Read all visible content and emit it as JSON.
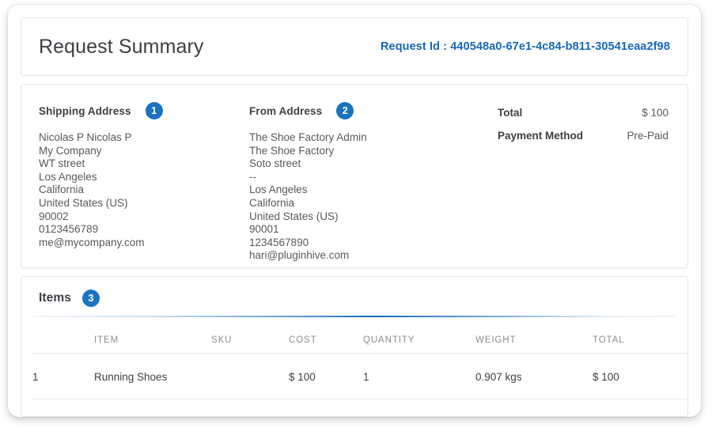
{
  "header": {
    "title": "Request Summary",
    "request_id_label": "Request Id : 440548a0-67e1-4c84-b811-30541eaa2f98",
    "accent_color": "#1668b8"
  },
  "addresses": {
    "shipping": {
      "heading": "Shipping Address",
      "badge": "1",
      "lines": [
        "Nicolas P Nicolas P",
        "My Company",
        "WT street",
        "Los Angeles",
        "California",
        "United States (US)",
        "90002",
        "0123456789",
        "me@mycompany.com"
      ]
    },
    "from": {
      "heading": "From Address",
      "badge": "2",
      "lines": [
        "The Shoe Factory Admin",
        "The Shoe Factory",
        "Soto street",
        "--",
        "Los Angeles",
        "California",
        "United States (US)",
        "90001",
        "1234567890",
        "hari@pluginhive.com"
      ]
    }
  },
  "summary": {
    "rows": [
      {
        "label": "Total",
        "value": "$ 100"
      },
      {
        "label": "Payment Method",
        "value": "Pre-Paid"
      }
    ]
  },
  "items": {
    "heading": "Items",
    "badge": "3",
    "columns": [
      "",
      "ITEM",
      "SKU",
      "COST",
      "QUANTITY",
      "WEIGHT",
      "TOTAL"
    ],
    "rows": [
      {
        "index": "1",
        "item": "Running Shoes",
        "sku": "",
        "cost": "$ 100",
        "quantity": "1",
        "weight": "0.907 kgs",
        "total": "$ 100"
      }
    ]
  }
}
